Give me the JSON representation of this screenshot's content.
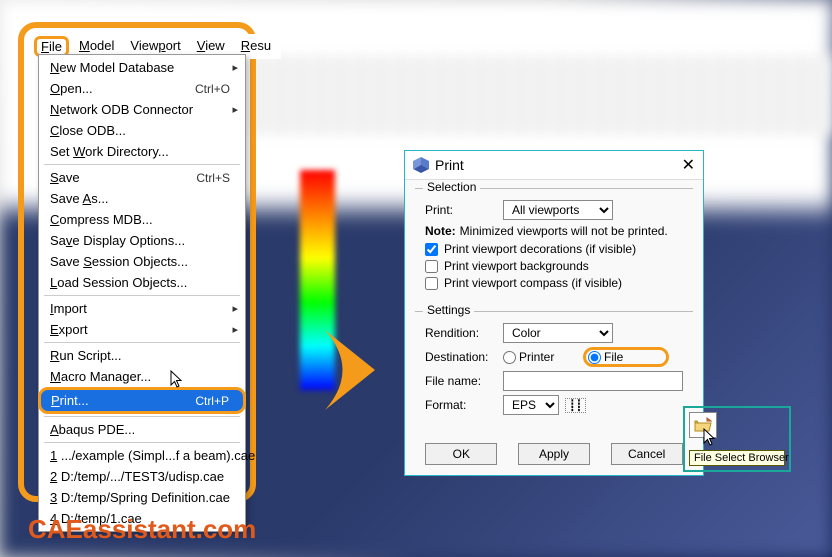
{
  "menubar": [
    "File",
    "Model",
    "Viewport",
    "View",
    "Resu"
  ],
  "menubar_underline_idx": [
    0,
    0,
    4,
    0,
    0
  ],
  "dropdown": {
    "groups": [
      [
        {
          "label": "New Model Database",
          "arrow": true
        },
        {
          "label": "Open...",
          "shortcut": "Ctrl+O"
        },
        {
          "label": "Network ODB Connector",
          "arrow": true
        },
        {
          "label": "Close ODB..."
        },
        {
          "label": "Set Work Directory..."
        }
      ],
      [
        {
          "label": "Save",
          "shortcut": "Ctrl+S"
        },
        {
          "label": "Save As..."
        },
        {
          "label": "Compress MDB..."
        },
        {
          "label": "Save Display Options..."
        },
        {
          "label": "Save Session Objects..."
        },
        {
          "label": "Load Session Objects..."
        }
      ],
      [
        {
          "label": "Import",
          "arrow": true
        },
        {
          "label": "Export",
          "arrow": true
        }
      ],
      [
        {
          "label": "Run Script..."
        },
        {
          "label": "Macro Manager..."
        },
        {
          "label": "Print...",
          "shortcut": "Ctrl+P",
          "selected": true,
          "highlighted": true
        }
      ],
      [
        {
          "label": "Abaqus PDE..."
        }
      ],
      [
        {
          "label": "1 .../example (Simpl...f a beam).cae"
        },
        {
          "label": "2 D:/temp/.../TEST3/udisp.cae"
        },
        {
          "label": "3 D:/temp/Spring Definition.cae"
        },
        {
          "label": "4 D:/temp/1.cae"
        }
      ]
    ],
    "underline_map": {
      "New Model Database": 0,
      "Open...": 0,
      "Network ODB Connector": 0,
      "Close ODB...": 0,
      "Set Work Directory...": 4,
      "Save": 0,
      "Save As...": 5,
      "Compress MDB...": 0,
      "Save Display Options...": 2,
      "Save Session Objects...": 5,
      "Load Session Objects...": 0,
      "Import": 0,
      "Export": 0,
      "Run Script...": 0,
      "Macro Manager...": 0,
      "Print...": 0,
      "Abaqus PDE...": 0,
      "1 .../example (Simpl...f a beam).cae": 0,
      "2 D:/temp/.../TEST3/udisp.cae": 0,
      "3 D:/temp/Spring Definition.cae": 0,
      "4 D:/temp/1.cae": 0
    }
  },
  "dialog": {
    "title": "Print",
    "selection": {
      "legend": "Selection",
      "print_label": "Print:",
      "print_value": "All viewports",
      "note_label": "Note:",
      "note_text": "Minimized viewports will not be printed.",
      "chk_decor": "Print viewport decorations (if visible)",
      "chk_bg": "Print viewport backgrounds",
      "chk_compass": "Print viewport compass (if visible)",
      "chk_decor_checked": true,
      "chk_bg_checked": false,
      "chk_compass_checked": false
    },
    "settings": {
      "legend": "Settings",
      "rendition_label": "Rendition:",
      "rendition_value": "Color",
      "destination_label": "Destination:",
      "dest_printer": "Printer",
      "dest_file": "File",
      "dest_selected": "File",
      "filename_label": "File name:",
      "filename_value": "",
      "format_label": "Format:",
      "format_value": "EPS"
    },
    "buttons": {
      "ok": "OK",
      "apply": "Apply",
      "cancel": "Cancel"
    },
    "tooltip": "File Select Browser"
  },
  "watermark": "CAEassistant.com"
}
